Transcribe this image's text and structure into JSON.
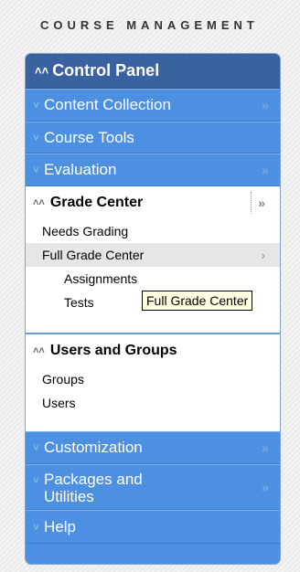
{
  "header": {
    "title": "COURSE MANAGEMENT"
  },
  "panel": {
    "title": "Control Panel",
    "items": {
      "content_collection": "Content Collection",
      "course_tools": "Course Tools",
      "evaluation": "Evaluation",
      "customization": "Customization",
      "packages_line1": "Packages and",
      "packages_line2": "Utilities",
      "help": "Help"
    },
    "grade_center": {
      "label": "Grade Center",
      "links": {
        "needs_grading": "Needs Grading",
        "full_grade_center": "Full Grade Center",
        "assignments": "Assignments",
        "tests": "Tests"
      }
    },
    "users_groups": {
      "label": "Users and Groups",
      "links": {
        "groups": "Groups",
        "users": "Users"
      }
    }
  },
  "tooltip": {
    "text": "Full Grade Center"
  },
  "colors": {
    "panel_title": "#3a62a1",
    "row_bg": "#4d8fe0",
    "tooltip_bg": "#ffffe1"
  }
}
